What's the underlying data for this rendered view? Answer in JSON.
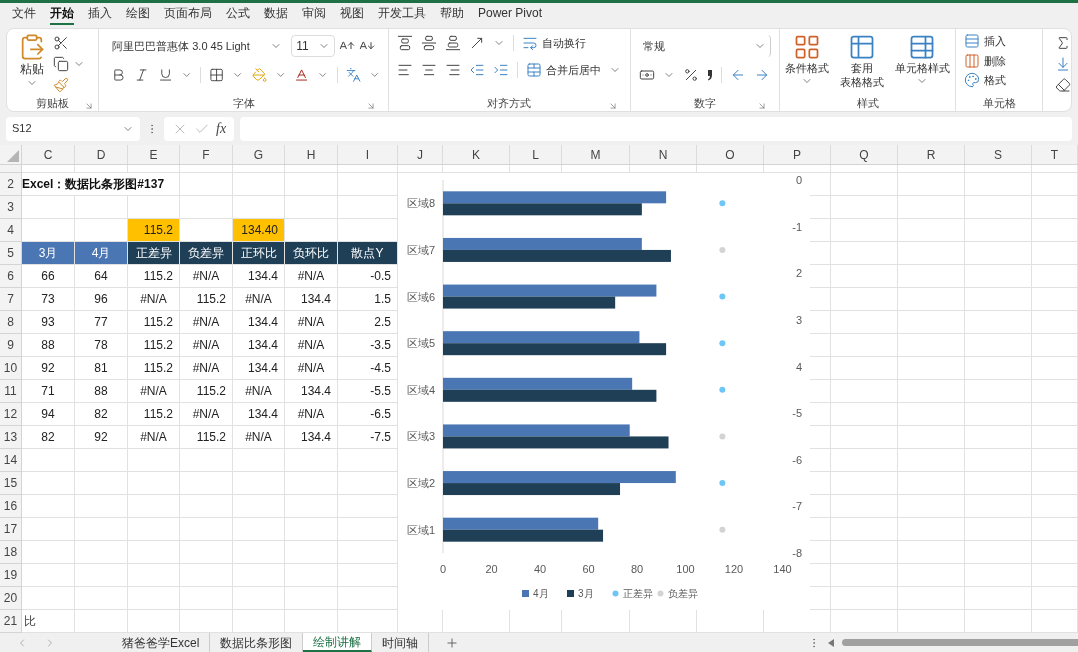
{
  "menu_tabs": [
    {
      "label": "文件",
      "selected": false
    },
    {
      "label": "开始",
      "selected": true
    },
    {
      "label": "插入",
      "selected": false
    },
    {
      "label": "绘图",
      "selected": false
    },
    {
      "label": "页面布局",
      "selected": false
    },
    {
      "label": "公式",
      "selected": false
    },
    {
      "label": "数据",
      "selected": false
    },
    {
      "label": "审阅",
      "selected": false
    },
    {
      "label": "视图",
      "selected": false
    },
    {
      "label": "开发工具",
      "selected": false
    },
    {
      "label": "帮助",
      "selected": false
    },
    {
      "label": "Power Pivot",
      "selected": false
    }
  ],
  "ribbon": {
    "clipboard": {
      "paste": "粘贴",
      "group": "剪贴板"
    },
    "font": {
      "name": "阿里巴巴普惠体 3.0 45 Light",
      "size": "11",
      "group": "字体"
    },
    "alignment": {
      "wrap": "自动换行",
      "merge": "合并后居中",
      "group": "对齐方式"
    },
    "number": {
      "format": "常规",
      "group": "数字"
    },
    "styles": {
      "conditional": "条件格式",
      "table_line1": "套用",
      "table_line2": "表格格式",
      "cell_styles": "单元格样式",
      "group": "样式"
    },
    "cells": {
      "insert": "插入",
      "delete": "删除",
      "format": "格式",
      "group": "单元格"
    }
  },
  "formula_bar": {
    "name_box": "S12",
    "function_label": "fx"
  },
  "columns": [
    "C",
    "D",
    "E",
    "F",
    "G",
    "H",
    "I",
    "J",
    "K",
    "L",
    "M",
    "N",
    "O",
    "P",
    "Q",
    "R",
    "S",
    "T"
  ],
  "rows": [
    {
      "cells": {}
    },
    {
      "header": "2",
      "cells": {
        "c": {
          "text": "Excel：数据比条形图#137",
          "kind": "title"
        }
      }
    },
    {
      "header": "3",
      "cells": {}
    },
    {
      "header": "4",
      "cells": {
        "e": {
          "text": "115.2",
          "kind": "highlight"
        },
        "g": {
          "text": "134.40",
          "kind": "highlight"
        }
      }
    },
    {
      "header": "5",
      "cells": {
        "c": {
          "text": "3月",
          "kind": "header_light"
        },
        "d": {
          "text": "4月",
          "kind": "header_light"
        },
        "e": {
          "text": "正差异",
          "kind": "header_dark"
        },
        "f": {
          "text": "负差异",
          "kind": "header_dark"
        },
        "g": {
          "text": "正环比",
          "kind": "header_dark"
        },
        "h": {
          "text": "负环比",
          "kind": "header_dark"
        },
        "i": {
          "text": "散点Y",
          "kind": "header_dark"
        }
      }
    },
    {
      "header": "6",
      "cells": {
        "c": {
          "text": "66",
          "kind": "center"
        },
        "d": {
          "text": "64",
          "kind": "center"
        },
        "e": {
          "text": "115.2",
          "kind": "number"
        },
        "f": {
          "text": "#N/A",
          "kind": "error"
        },
        "g": {
          "text": "134.4",
          "kind": "number"
        },
        "h": {
          "text": "#N/A",
          "kind": "error"
        },
        "i": {
          "text": "-0.5",
          "kind": "number"
        }
      }
    },
    {
      "header": "7",
      "cells": {
        "c": {
          "text": "73",
          "kind": "center"
        },
        "d": {
          "text": "96",
          "kind": "center"
        },
        "e": {
          "text": "#N/A",
          "kind": "error"
        },
        "f": {
          "text": "115.2",
          "kind": "number"
        },
        "g": {
          "text": "#N/A",
          "kind": "error"
        },
        "h": {
          "text": "134.4",
          "kind": "number"
        },
        "i": {
          "text": "1.5",
          "kind": "number"
        }
      }
    },
    {
      "header": "8",
      "cells": {
        "c": {
          "text": "93",
          "kind": "center"
        },
        "d": {
          "text": "77",
          "kind": "center"
        },
        "e": {
          "text": "115.2",
          "kind": "number"
        },
        "f": {
          "text": "#N/A",
          "kind": "error"
        },
        "g": {
          "text": "134.4",
          "kind": "number"
        },
        "h": {
          "text": "#N/A",
          "kind": "error"
        },
        "i": {
          "text": "2.5",
          "kind": "number"
        }
      }
    },
    {
      "header": "9",
      "cells": {
        "c": {
          "text": "88",
          "kind": "center"
        },
        "d": {
          "text": "78",
          "kind": "center"
        },
        "e": {
          "text": "115.2",
          "kind": "number"
        },
        "f": {
          "text": "#N/A",
          "kind": "error"
        },
        "g": {
          "text": "134.4",
          "kind": "number"
        },
        "h": {
          "text": "#N/A",
          "kind": "error"
        },
        "i": {
          "text": "-3.5",
          "kind": "number"
        }
      }
    },
    {
      "header": "10",
      "cells": {
        "c": {
          "text": "92",
          "kind": "center"
        },
        "d": {
          "text": "81",
          "kind": "center"
        },
        "e": {
          "text": "115.2",
          "kind": "number"
        },
        "f": {
          "text": "#N/A",
          "kind": "error"
        },
        "g": {
          "text": "134.4",
          "kind": "number"
        },
        "h": {
          "text": "#N/A",
          "kind": "error"
        },
        "i": {
          "text": "-4.5",
          "kind": "number"
        }
      }
    },
    {
      "header": "11",
      "cells": {
        "c": {
          "text": "71",
          "kind": "center"
        },
        "d": {
          "text": "88",
          "kind": "center"
        },
        "e": {
          "text": "#N/A",
          "kind": "error"
        },
        "f": {
          "text": "115.2",
          "kind": "number"
        },
        "g": {
          "text": "#N/A",
          "kind": "error"
        },
        "h": {
          "text": "134.4",
          "kind": "number"
        },
        "i": {
          "text": "-5.5",
          "kind": "number"
        }
      }
    },
    {
      "header": "12",
      "cells": {
        "c": {
          "text": "94",
          "kind": "center"
        },
        "d": {
          "text": "82",
          "kind": "center"
        },
        "e": {
          "text": "115.2",
          "kind": "number"
        },
        "f": {
          "text": "#N/A",
          "kind": "error"
        },
        "g": {
          "text": "134.4",
          "kind": "number"
        },
        "h": {
          "text": "#N/A",
          "kind": "error"
        },
        "i": {
          "text": "-6.5",
          "kind": "number"
        }
      }
    },
    {
      "header": "13",
      "cells": {
        "c": {
          "text": "82",
          "kind": "center"
        },
        "d": {
          "text": "92",
          "kind": "center"
        },
        "e": {
          "text": "#N/A",
          "kind": "error"
        },
        "f": {
          "text": "115.2",
          "kind": "number"
        },
        "g": {
          "text": "#N/A",
          "kind": "error"
        },
        "h": {
          "text": "134.4",
          "kind": "number"
        },
        "i": {
          "text": "-7.5",
          "kind": "number"
        }
      }
    },
    {
      "header": "14",
      "cells": {}
    },
    {
      "header": "15",
      "cells": {}
    },
    {
      "header": "16",
      "cells": {}
    },
    {
      "header": "17",
      "cells": {}
    },
    {
      "header": "18",
      "cells": {}
    },
    {
      "header": "19",
      "cells": {}
    },
    {
      "header": "20",
      "cells": {}
    },
    {
      "header": "21",
      "cells": {
        "c": {
          "text": "比",
          "kind": "note"
        }
      }
    }
  ],
  "chart": {
    "chart_data": {
      "type": "bar",
      "orientation": "horizontal",
      "stacked": false,
      "legend": "bottom",
      "categories": [
        "区域8",
        "区域7",
        "区域6",
        "区域5",
        "区域4",
        "区域3",
        "区域2",
        "区域1"
      ],
      "xlim": [
        0,
        140
      ],
      "xticks": [
        0,
        20,
        40,
        60,
        80,
        100,
        120,
        140
      ],
      "series": [
        {
          "name": "4月",
          "type": "bar",
          "color": "#4a76b4",
          "values": [
            92,
            82,
            88,
            81,
            78,
            77,
            96,
            64
          ]
        },
        {
          "name": "3月",
          "type": "bar",
          "color": "#1f3f57",
          "values": [
            82,
            94,
            71,
            92,
            88,
            93,
            73,
            66
          ]
        },
        {
          "name": "正差异",
          "type": "scatter",
          "color": "#6ec6f5",
          "values": [
            115.2,
            null,
            115.2,
            115.2,
            115.2,
            null,
            115.2,
            null
          ]
        },
        {
          "name": "负差异",
          "type": "scatter",
          "color": "#d3d3d3",
          "values": [
            null,
            115.2,
            null,
            null,
            null,
            115.2,
            null,
            115.2
          ]
        }
      ]
    },
    "secondary_axis_labels": [
      "0",
      "-1",
      "2",
      "3",
      "4",
      "-5",
      "-6",
      "-7",
      "-8"
    ]
  },
  "sheet_tabs": [
    {
      "label": "猪爸爸学Excel",
      "selected": false
    },
    {
      "label": "数据比条形图",
      "selected": false
    },
    {
      "label": "绘制讲解",
      "selected": true
    },
    {
      "label": "时间轴",
      "selected": false
    }
  ]
}
